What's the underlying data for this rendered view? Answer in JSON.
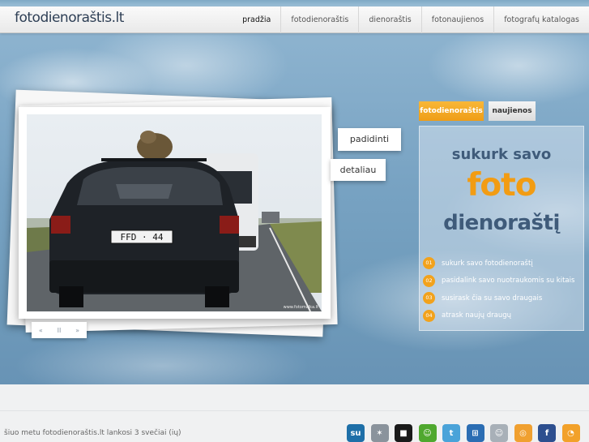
{
  "header": {
    "logo": "fotodienoraštis.lt",
    "nav": [
      {
        "label": "pradžia",
        "active": true
      },
      {
        "label": "fotodienoraštis",
        "active": false
      },
      {
        "label": "dienoraštis",
        "active": false
      },
      {
        "label": "fotonaujienos",
        "active": false
      },
      {
        "label": "fotografų katalogas",
        "active": false
      }
    ]
  },
  "slideshow": {
    "enlarge_label": "padidinti",
    "details_label": "detaliau",
    "photo_credit": "www.fotomaika.lt",
    "plate_text": "FFD · 44",
    "controls": {
      "prev": "«",
      "pause": "II",
      "next": "»"
    }
  },
  "panel": {
    "tabs": [
      {
        "label": "fotodienoraštis",
        "active": true
      },
      {
        "label": "naujienos",
        "active": false
      }
    ],
    "promo_line1": "sukurk savo",
    "promo_line2": "foto",
    "promo_line3": "dienoraštį",
    "steps": [
      {
        "num": "01",
        "text": "sukurk savo fotodienoraštį"
      },
      {
        "num": "02",
        "text": "pasidalink savo nuotraukomis su kitais"
      },
      {
        "num": "03",
        "text": "susirask čia su savo draugais"
      },
      {
        "num": "04",
        "text": "atrask naujų draugų"
      }
    ]
  },
  "footer": {
    "status": "šiuo metu fotodienoraštis.lt lankosi 3 svečiai (ių)",
    "social_icons": [
      {
        "name": "stumbleupon-icon",
        "glyph": "su",
        "color": "#1e6fa8"
      },
      {
        "name": "myspace-icon",
        "glyph": "✶",
        "color": "#8a939c"
      },
      {
        "name": "delicious-icon",
        "glyph": "■",
        "color": "#1a1a1a"
      },
      {
        "name": "chat-icon",
        "glyph": "☺",
        "color": "#4fa82f"
      },
      {
        "name": "twitter-icon",
        "glyph": "t",
        "color": "#4aa3d9"
      },
      {
        "name": "windows-live-icon",
        "glyph": "⊞",
        "color": "#2b6db3"
      },
      {
        "name": "digg-icon",
        "glyph": "☺",
        "color": "#a8b0b8"
      },
      {
        "name": "reddit-icon",
        "glyph": "◎",
        "color": "#f0a030"
      },
      {
        "name": "facebook-icon",
        "glyph": "f",
        "color": "#2d4f8f"
      },
      {
        "name": "rss-icon",
        "glyph": "◔",
        "color": "#f2a12a"
      }
    ]
  }
}
